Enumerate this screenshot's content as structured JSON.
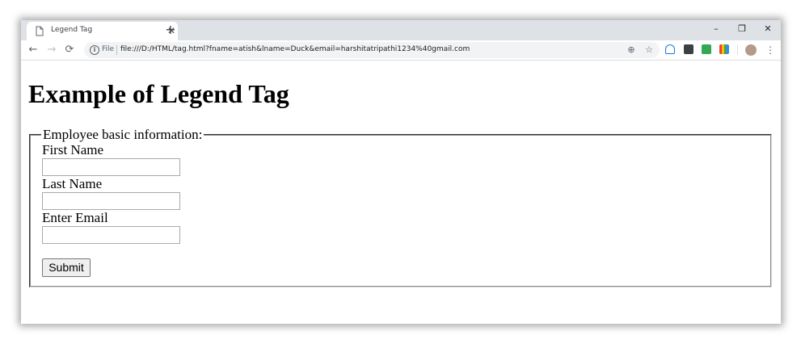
{
  "browser": {
    "tab": {
      "title": "Legend Tag",
      "close_icon": "close-icon"
    },
    "new_tab_label": "+",
    "window_controls": {
      "minimize": "–",
      "restore": "❐",
      "close": "✕"
    },
    "nav": {
      "back": "←",
      "forward": "→",
      "reload": "⟳"
    },
    "omnibox": {
      "info_glyph": "i",
      "scheme_label": "File",
      "url": "file:///D:/HTML/tag.html?fname=atish&lname=Duck&email=harshitatripathi1234%40gmail.com",
      "zoom_glyph": "⊕",
      "star_glyph": "☆"
    },
    "menu_glyph": "⋮",
    "colors": {
      "tabstrip": "#dee1e6",
      "omnibox": "#f1f3f4"
    }
  },
  "page": {
    "heading": "Example of Legend Tag",
    "legend": "Employee basic information:",
    "fields": [
      {
        "label": "First Name",
        "value": ""
      },
      {
        "label": "Last Name",
        "value": ""
      },
      {
        "label": "Enter Email",
        "value": ""
      }
    ],
    "submit_label": "Submit"
  }
}
